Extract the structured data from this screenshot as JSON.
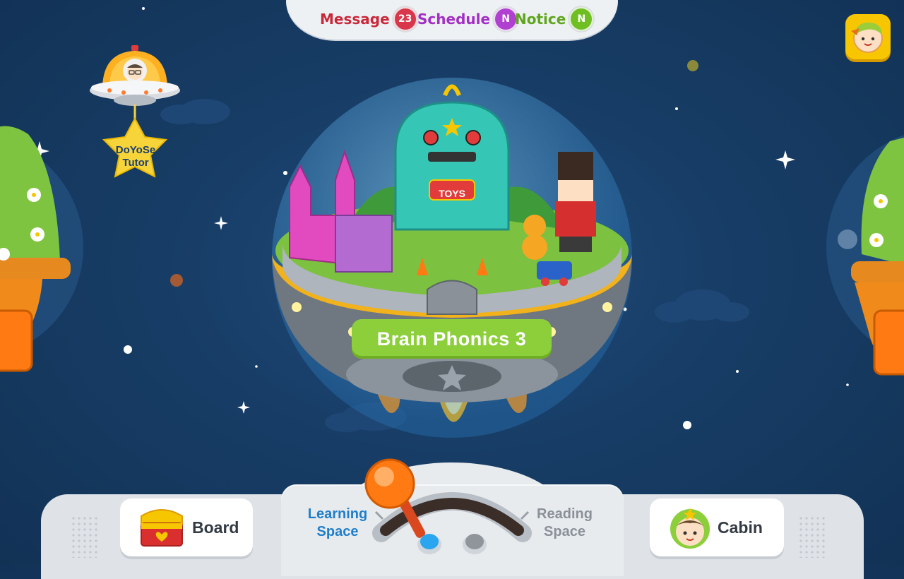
{
  "top_bar": {
    "message_label": "Message",
    "message_count": "23",
    "schedule_label": "Schedule",
    "schedule_badge": "N",
    "notice_label": "Notice",
    "notice_badge": "N"
  },
  "tutor": {
    "label_line1": "DoYoSe",
    "label_line2": "Tutor"
  },
  "planet": {
    "title": "Brain Phonics 3",
    "sign_text": "TOYS"
  },
  "bottom": {
    "board_label": "Board",
    "learning_line1": "Learning",
    "learning_line2": "Space",
    "reading_line1": "Reading",
    "reading_line2": "Space",
    "cabin_label": "Cabin",
    "lever_position": "learning"
  },
  "colors": {
    "message": "#c8283a",
    "schedule": "#a22fc4",
    "notice": "#5fa51e",
    "learning_space": "#1f7ec9",
    "reading_space": "#8a9098",
    "background": "#173d66",
    "planet_label": "#8ccf3b",
    "avatar_button": "#f8c600"
  },
  "icons": {
    "avatar": "boy-avatar-icon",
    "board": "treasure-chest-icon",
    "cabin": "kid-face-icon",
    "tutor": "ufo-tutor-icon",
    "lever": "joystick-lever-icon"
  }
}
